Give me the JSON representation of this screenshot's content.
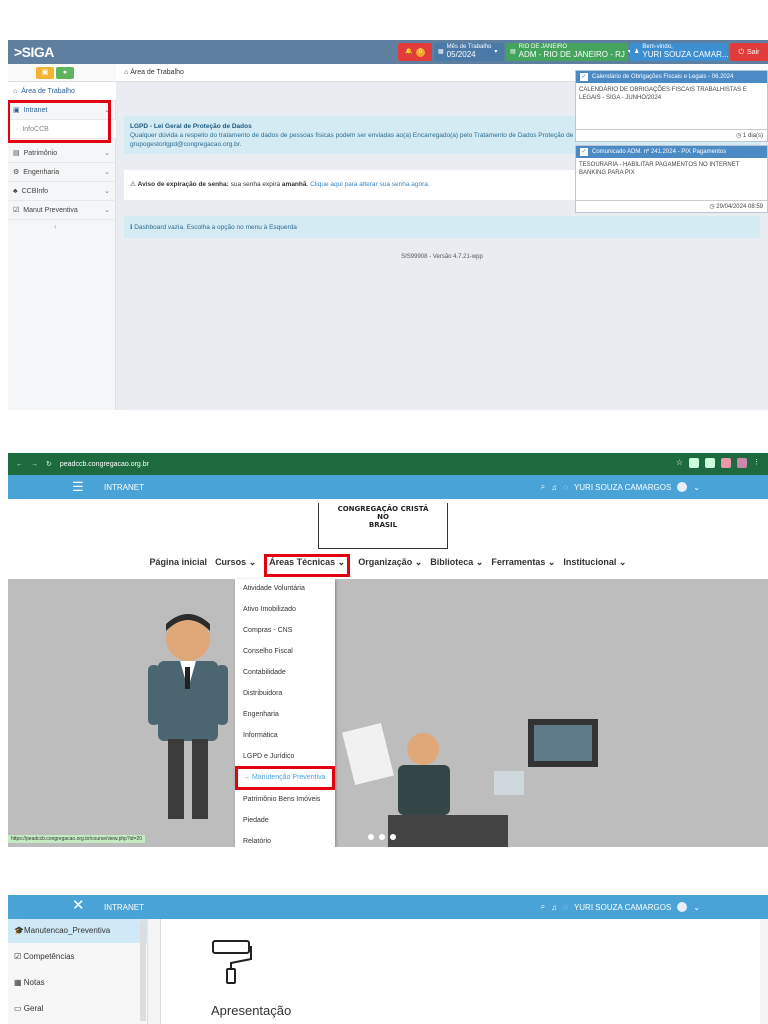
{
  "siga": {
    "logo": ">SIGA",
    "badge_count": "0",
    "mes_label": "Mês de Trabalho",
    "mes_value": "05/2024",
    "regiao_top": "RIO DE JANEIRO",
    "regiao_bottom": "ADM - RIO DE JANEIRO - RJ",
    "welcome": "Bem-vindo,",
    "user": "YURI SOUZA CAMAR...",
    "sair": "Sair",
    "sidebar": [
      {
        "label": "Área de Trabalho"
      },
      {
        "label": "Intranet"
      },
      {
        "label": "InfoCCB"
      },
      {
        "label": "Patrimônio"
      },
      {
        "label": "Engenharia"
      },
      {
        "label": "CCBInfo"
      },
      {
        "label": "Manut Preventiva"
      }
    ],
    "breadcrumb": "Área de Trabalho",
    "lgpd_title": "LGPD - Lei Geral de Proteção de Dados",
    "lgpd_text": "Qualquer dúvida a respeito do tratamento de dados de pessoas físicas podem ser enviadas ao(a) Encarregado(a) pelo Tratamento de Dados Proteção de Dados Pessoais, no e-mail grupogestorlgpd@congregacao.org.br.",
    "senha_title": "Aviso de expiração de senha:",
    "senha_text": " sua senha expira ",
    "senha_when": "amanhã",
    "senha_link": "Clique aqui para alterar sua senha agora.",
    "dash_text": "Dashboard vazia. Escolha a opção no menu à Esquerda",
    "version": "SIS99908 - Versão 4.7.21-wpp",
    "notifications": [
      {
        "title": "Calendário de Obrigações Fiscais e Legais - 06.2024",
        "body": "CALENDÁRIO DE OBRIGAÇÕES FISCAIS TRABALHISTAS E LEGAIS - SIGA - JUNHO/2024",
        "footer": "1 dia(s)"
      },
      {
        "title": "Comunicado ADM. nº 241.2024 - PIX Pagamentos",
        "body": "TESOURARIA - HABILITAR PAGAMENTOS NO INTERNET BANKING PARA PIX",
        "footer": "29/04/2024 08:59"
      }
    ]
  },
  "browser": {
    "url": "peadccb.congregacao.org.br",
    "bar_title": "INTRANET",
    "user": "YURI SOUZA CAMARGOS",
    "logo_lines": [
      "CONGREGAÇÃO CRISTÃ",
      "NO",
      "BRASIL"
    ],
    "menu": [
      "Página inicial",
      "Cursos ⌄",
      "Áreas Técnicas ⌄",
      "Organização ⌄",
      "Biblioteca ⌄",
      "Ferramentas ⌄",
      "Institucional ⌄"
    ],
    "dropdown": [
      "Atividade Voluntária",
      "Ativo Imobilizado",
      "Compras - CNS",
      "Conselho Fiscal",
      "Contabilidade",
      "Distribuidora",
      "Engenharia",
      "Informática",
      "LGPD e Jurídico",
      "→ Manutenção Preventiva",
      "Patrimônio Bens Imóveis",
      "Piedade",
      "Relatório"
    ],
    "status_url": "https://peadccb.congregacao.org.br/course/view.php?id=20"
  },
  "course": {
    "bar_title": "INTRANET",
    "user": "YURI SOUZA CAMARGOS",
    "side": [
      "Manutencao_Preventiva",
      "Competências",
      "Notas",
      "Geral"
    ],
    "heading": "Apresentação"
  },
  "colors": {
    "siga_bar": "#5f7fa0",
    "intranet_bar": "#4aa3d6",
    "highlight": "#e3000f",
    "chrome": "#1c6a3e"
  }
}
